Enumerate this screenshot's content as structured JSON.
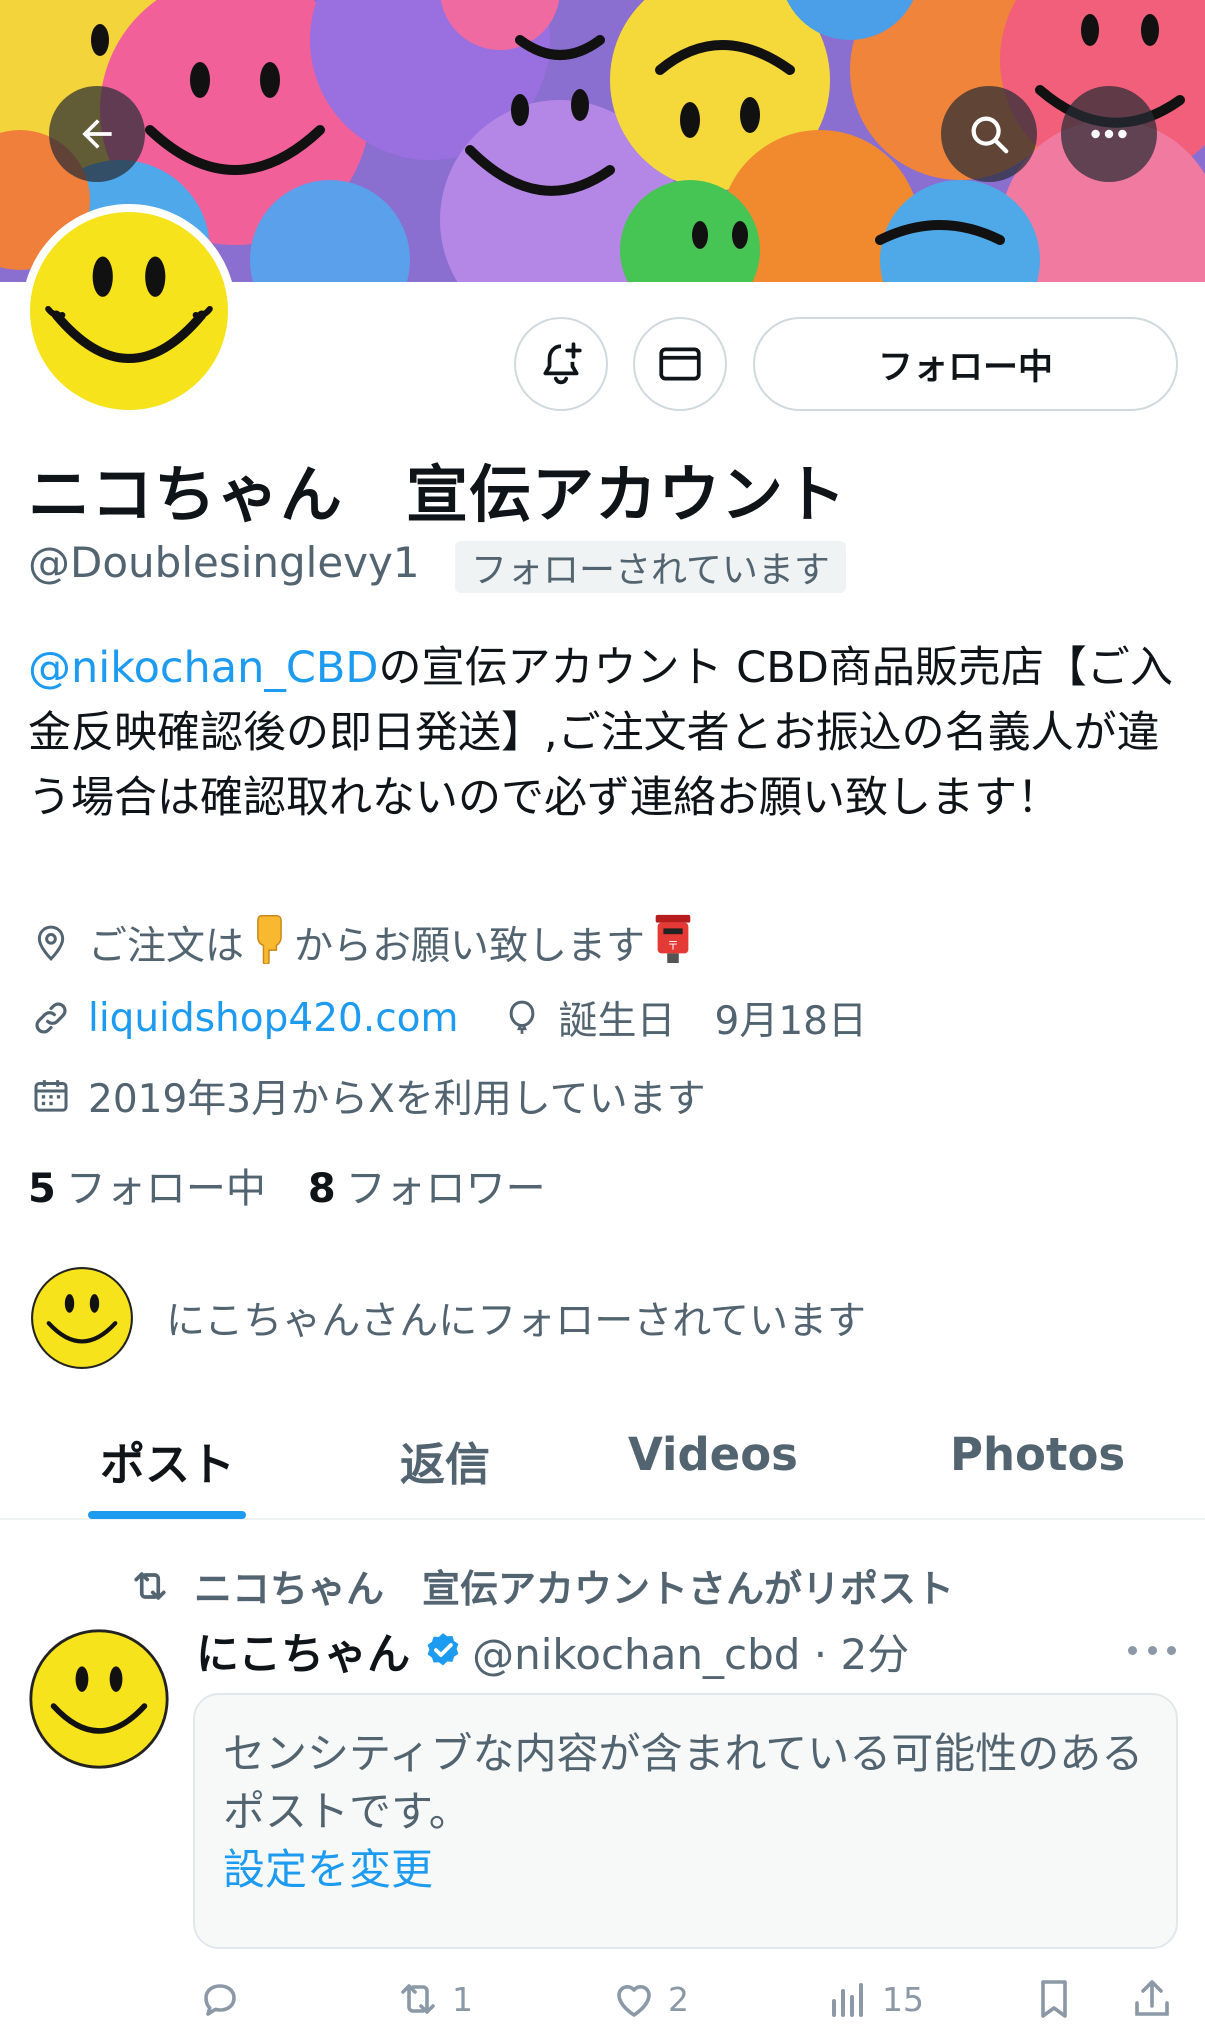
{
  "header": {
    "back_icon": "arrow-left-icon",
    "search_icon": "search-icon",
    "more_icon": "more-horizontal-icon"
  },
  "profile": {
    "display_name": "ニコちゃん　宣伝アカウント",
    "handle": "@Doublesinglevy1",
    "follows_you_badge": "フォローされています",
    "follow_button_label": "フォロー中",
    "notify_icon": "bell-plus-icon",
    "dm_icon": "envelope-icon",
    "bio": {
      "mention": "@nikochan_CBD",
      "text": "の宣伝アカウント CBD商品販売店【ご入金反映確認後の即日発送】,ご注文者とお振込の名義人が違う場合は確認取れないので必ず連絡お願い致します！"
    },
    "location": {
      "prefix": "ご注文は",
      "suffix": "からお願い致します",
      "icon": "location-pin-icon"
    },
    "website": "liquidshop420.com",
    "birthday": "誕生日　9月18日",
    "joined": "2019年3月からXを利用しています"
  },
  "stats": {
    "following_count": "5",
    "following_label": "フォロー中",
    "followers_count": "8",
    "followers_label": "フォロワー"
  },
  "followed_by": {
    "text": "にこちゃんさんにフォローされています"
  },
  "tabs": [
    {
      "label": "ポスト",
      "active": true
    },
    {
      "label": "返信",
      "active": false
    },
    {
      "label": "Videos",
      "active": false
    },
    {
      "label": "Photos",
      "active": false
    }
  ],
  "post": {
    "repost_text": "ニコちゃん　宣伝アカウントさんがリポスト",
    "author_name": "にこちゃん",
    "author_handle_time": "@nikochan_cbd · 2分",
    "sensitive_message": "センシティブな内容が含まれている可能性のあるポストです。",
    "change_settings_link": "設定を変更",
    "actions": {
      "reply_count": "",
      "repost_count": "1",
      "like_count": "2",
      "views_count": "15"
    }
  },
  "colors": {
    "accent": "#1d9bf0",
    "text_primary": "#0f1419",
    "text_secondary": "#536471",
    "verified": "#1d9bf0"
  }
}
